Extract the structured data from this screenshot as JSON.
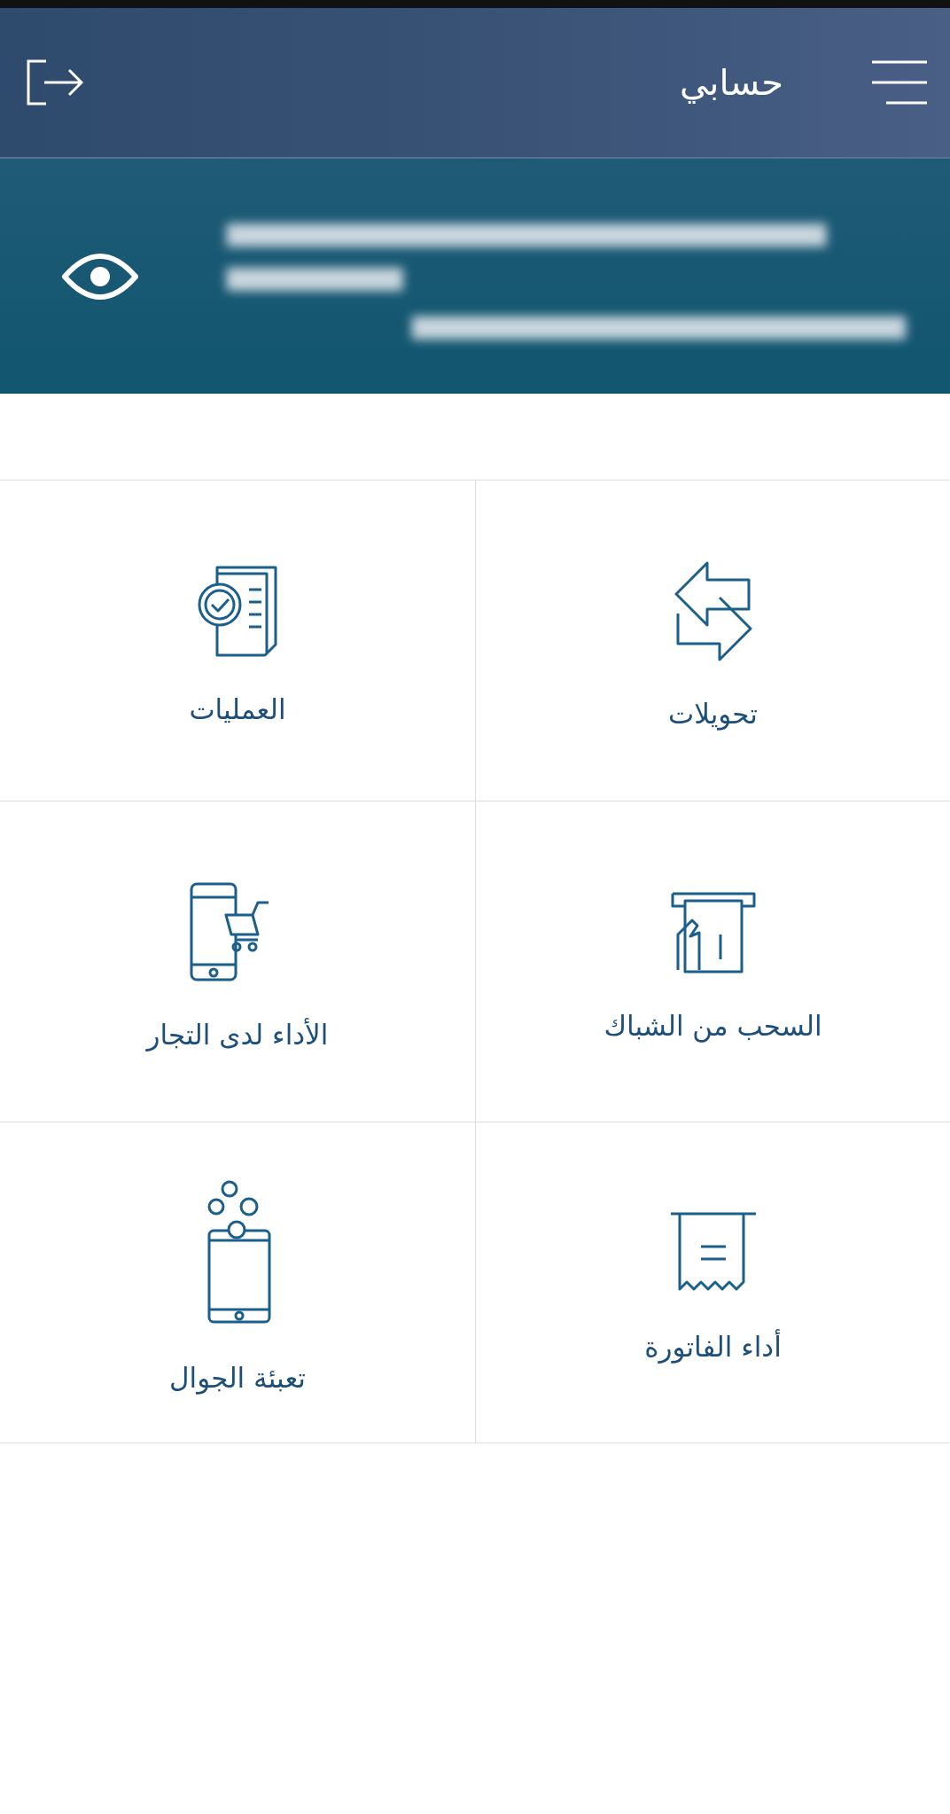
{
  "header": {
    "title": "حسابي"
  },
  "account": {
    "masked": true
  },
  "tiles": [
    {
      "label": "تحويلات",
      "kind": "transfer"
    },
    {
      "label": "العمليات",
      "kind": "operations"
    },
    {
      "label": "السحب من الشباك",
      "kind": "atm"
    },
    {
      "label": "الأداء لدى التجار",
      "kind": "merchant"
    },
    {
      "label": "أداء الفاتورة",
      "kind": "bill"
    },
    {
      "label": "تعبئة الجوال",
      "kind": "topup"
    }
  ]
}
